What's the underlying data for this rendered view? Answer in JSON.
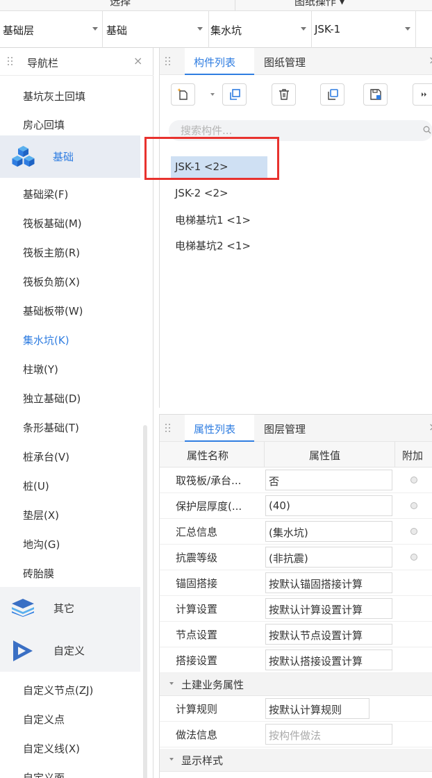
{
  "top_toolbar": {
    "left_label": "选择",
    "right_label": "图纸操作 ▾"
  },
  "dropdowns": [
    {
      "value": "基础层"
    },
    {
      "value": "基础"
    },
    {
      "value": "集水坑"
    },
    {
      "value": "JSK-1"
    }
  ],
  "nav": {
    "title": "导航栏",
    "close": "×",
    "items_top": [
      "基坑灰土回填",
      "房心回填"
    ],
    "category_foundation": "基础",
    "items": [
      "基础梁(F)",
      "筏板基础(M)",
      "筏板主筋(R)",
      "筏板负筋(X)",
      "基础板带(W)",
      "集水坑(K)",
      "柱墩(Y)",
      "独立基础(D)",
      "条形基础(T)",
      "桩承台(V)",
      "桩(U)",
      "垫层(X)",
      "地沟(G)",
      "砖胎膜"
    ],
    "active_item": "集水坑(K)",
    "category_other": "其它",
    "category_custom": "自定义",
    "custom_items": [
      "自定义节点(ZJ)",
      "自定义点",
      "自定义线(X)",
      "自定义面"
    ]
  },
  "component_panel": {
    "tabs": [
      "构件列表",
      "图纸管理"
    ],
    "close": "×",
    "toolbar_icons": [
      "new-icon",
      "copy-icon",
      "delete-icon",
      "layer-copy-icon",
      "save-icon",
      "more-icon"
    ],
    "search_placeholder": "搜索构件...",
    "components": [
      "JSK-1 <2>",
      "JSK-2 <2>",
      "电梯基坑1 <1>",
      "电梯基坑2 <1>"
    ],
    "selected": "JSK-1 <2>"
  },
  "property_panel": {
    "tabs": [
      "属性列表",
      "图层管理"
    ],
    "close": "×",
    "columns": [
      "属性名称",
      "属性值",
      "附加"
    ],
    "rows": [
      {
        "name": "取筏板/承台...",
        "value": "否",
        "radio": true
      },
      {
        "name": "保护层厚度(...",
        "value": "(40)",
        "radio": true
      },
      {
        "name": "汇总信息",
        "value": "(集水坑)",
        "radio": true
      },
      {
        "name": "抗震等级",
        "value": "(非抗震)",
        "radio": true
      },
      {
        "name": "锚固搭接",
        "value": "按默认锚固搭接计算",
        "radio": false
      },
      {
        "name": "计算设置",
        "value": "按默认计算设置计算",
        "radio": false
      },
      {
        "name": "节点设置",
        "value": "按默认节点设置计算",
        "radio": false
      },
      {
        "name": "搭接设置",
        "value": "按默认搭接设置计算",
        "radio": false
      }
    ],
    "group_civil": "土建业务属性",
    "civil_rows": [
      {
        "name": "计算规则",
        "value": "按默认计算规则"
      },
      {
        "name": "做法信息",
        "value": "按构件做法"
      }
    ],
    "group_display": "显示样式"
  },
  "colors": {
    "accent": "#2f7de1",
    "highlight": "#cfe0f3",
    "annotation_red": "#e8322e"
  }
}
